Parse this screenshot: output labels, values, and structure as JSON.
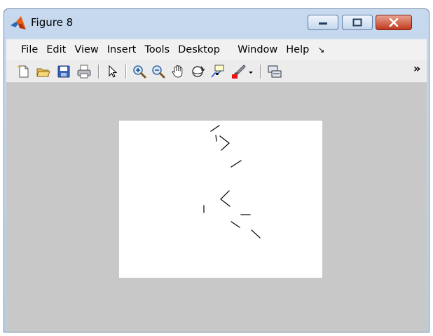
{
  "window": {
    "title": "Figure 8",
    "controls": {
      "minimize": "minimize",
      "maximize": "maximize",
      "close": "close"
    }
  },
  "menubar": {
    "items": [
      "File",
      "Edit",
      "View",
      "Insert",
      "Tools",
      "Desktop",
      "Window",
      "Help"
    ],
    "overflow_glyph": "↘"
  },
  "toolbar": {
    "tools": [
      "new-figure-icon",
      "open-file-icon",
      "save-icon",
      "print-icon",
      "edit-plot-icon",
      "zoom-in-icon",
      "zoom-out-icon",
      "pan-icon",
      "rotate-3d-icon",
      "data-cursor-icon",
      "brush-icon",
      "brush-dropdown-icon",
      "link-plot-icon"
    ],
    "overflow_glyph": "»"
  },
  "colors": {
    "accent": "#cc2200",
    "figure_bg": "#c8c8c8",
    "axes_bg": "#ffffff"
  }
}
